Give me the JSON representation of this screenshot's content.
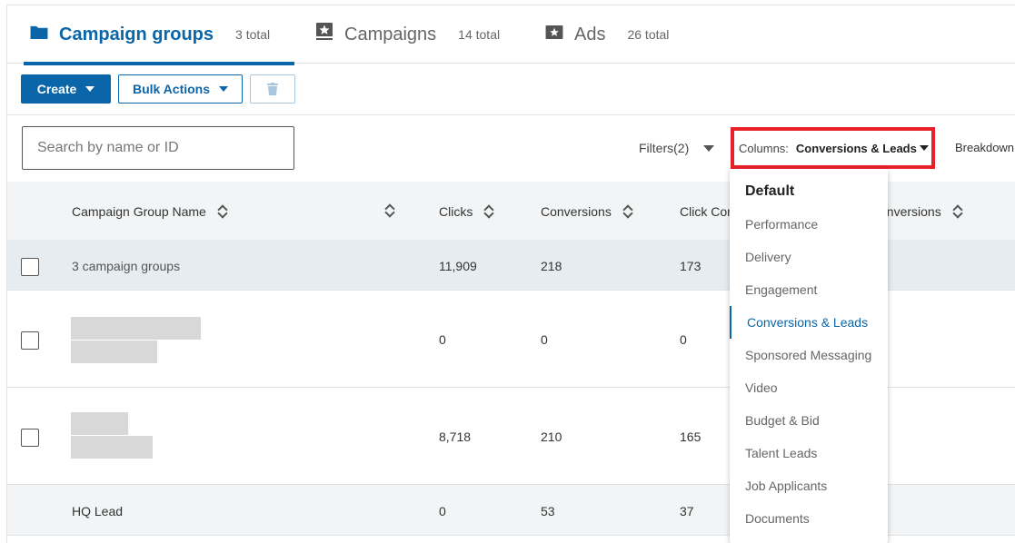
{
  "tabs": [
    {
      "label": "Campaign groups",
      "count": "3 total",
      "icon": "folder-icon",
      "active": true
    },
    {
      "label": "Campaigns",
      "count": "14 total",
      "icon": "campaign-icon"
    },
    {
      "label": "Ads",
      "count": "26 total",
      "icon": "ad-star-icon"
    }
  ],
  "toolbar": {
    "create_label": "Create",
    "bulk_label": "Bulk Actions",
    "delete_icon": "trash-icon"
  },
  "filter_row": {
    "search_placeholder": "Search by name or ID",
    "filters_label": "Filters",
    "filters_count": "(2)",
    "columns_label": "Columns:",
    "columns_value": "Conversions & Leads",
    "breakdown_label": "Breakdown"
  },
  "table": {
    "headers": {
      "name": "Campaign Group Name",
      "clicks": "Clicks",
      "conversions": "Conversions",
      "click_conv": "Click Con",
      "view_conv": "onversions"
    },
    "summary": {
      "name": "3 campaign groups",
      "clicks": "11,909",
      "conversions": "218",
      "click_conv": "173"
    },
    "rows": [
      {
        "clicks": "0",
        "conversions": "0",
        "click_conv": "0"
      },
      {
        "clicks": "8,718",
        "conversions": "210",
        "click_conv": "165"
      },
      {
        "name": "HQ Lead",
        "clicks": "0",
        "conversions": "53",
        "click_conv": "37"
      }
    ]
  },
  "dropdown": {
    "header": "Default",
    "items": [
      "Performance",
      "Delivery",
      "Engagement",
      "Conversions & Leads",
      "Sponsored Messaging",
      "Video",
      "Budget & Bid",
      "Talent Leads",
      "Job Applicants",
      "Documents"
    ],
    "selected": "Conversions & Leads"
  },
  "colors": {
    "accent": "#0a66a8",
    "highlight_border": "#e8202a"
  }
}
